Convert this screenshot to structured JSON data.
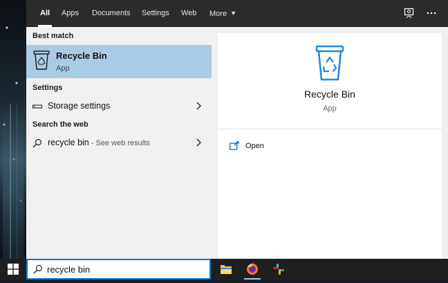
{
  "tabs": [
    {
      "label": "All",
      "active": true
    },
    {
      "label": "Apps"
    },
    {
      "label": "Documents"
    },
    {
      "label": "Settings"
    },
    {
      "label": "Web"
    },
    {
      "label": "More"
    }
  ],
  "top_icons": [
    "feedback-icon",
    "more-options-icon"
  ],
  "results": {
    "best_match_heading": "Best match",
    "best_match": {
      "title": "Recycle Bin",
      "subtitle": "App",
      "icon": "recycle-bin-icon"
    },
    "settings_heading": "Settings",
    "settings_item": {
      "label": "Storage settings",
      "icon": "storage-icon"
    },
    "web_heading": "Search the web",
    "web_item": {
      "query": "recycle bin",
      "suffix": " - See web results",
      "icon": "search-icon"
    }
  },
  "preview": {
    "title": "Recycle Bin",
    "subtitle": "App",
    "actions": [
      {
        "label": "Open",
        "icon": "open-icon"
      }
    ]
  },
  "taskbar": {
    "search_value": "recycle bin",
    "apps": [
      "file-explorer-icon",
      "firefox-icon",
      "slack-icon"
    ]
  },
  "colors": {
    "accent": "#0078d7",
    "selection": "#aacbe4",
    "recycle_blue": "#1e88e5"
  }
}
